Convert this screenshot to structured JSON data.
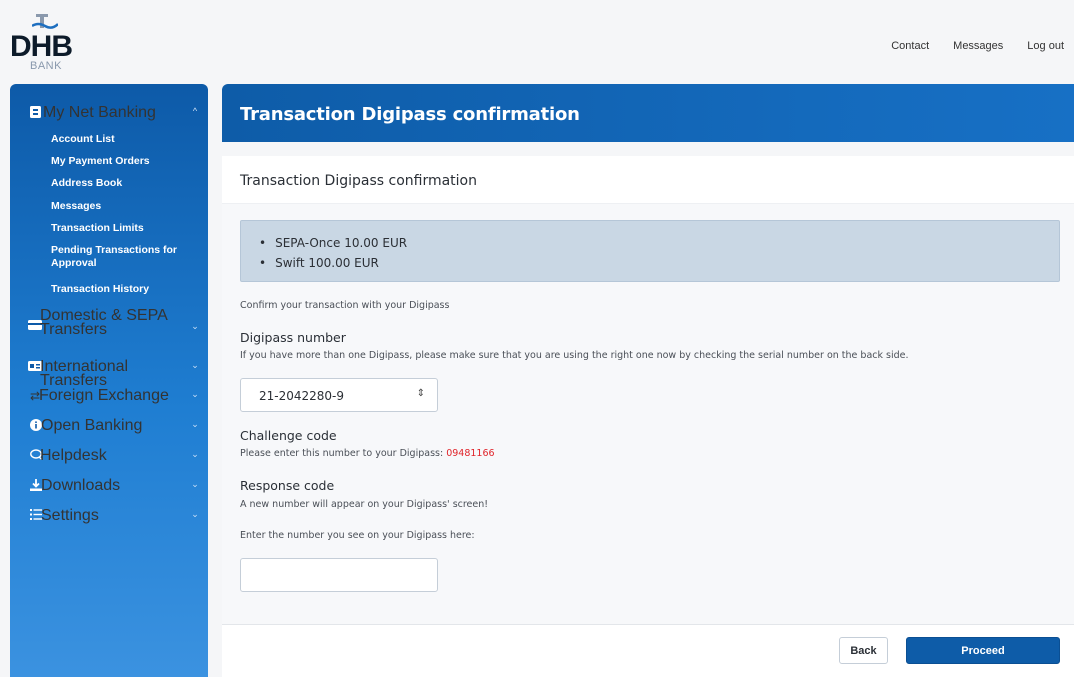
{
  "brand": {
    "name": "DHB",
    "sub": "BANK"
  },
  "top_nav": {
    "contact": "Contact",
    "messages": "Messages",
    "logout": "Log out"
  },
  "sidebar": {
    "my_net_banking": {
      "label": "My Net Banking",
      "icon": "account-icon",
      "items": [
        "Account List",
        "My Payment Orders",
        "Address Book",
        "Messages",
        "Transaction Limits",
        "Pending Transactions for Approval",
        "Transaction History"
      ]
    },
    "groups": [
      {
        "label": "Domestic & SEPA Transfers",
        "icon": "card-icon"
      },
      {
        "label": "International Transfers",
        "icon": "id-card-icon"
      },
      {
        "label": "Foreign Exchange",
        "icon": "exchange-icon"
      },
      {
        "label": "Open Banking",
        "icon": "info-icon"
      },
      {
        "label": "Helpdesk",
        "icon": "chat-icon"
      },
      {
        "label": "Downloads",
        "icon": "download-icon"
      },
      {
        "label": "Settings",
        "icon": "list-icon"
      }
    ]
  },
  "page": {
    "title": "Transaction Digipass confirmation",
    "card_title": "Transaction Digipass confirmation",
    "summary": [
      "SEPA-Once 10.00 EUR",
      "Swift 100.00 EUR"
    ],
    "confirm_text": "Confirm your transaction with your Digipass",
    "digipass_label": "Digipass number",
    "digipass_help": "If you have more than one Digipass, please make sure that you are using the right one now by checking the serial number on the back side.",
    "digipass_value": "21-2042280-9",
    "challenge_label": "Challenge code",
    "challenge_help": "Please enter this number to your Digipass: ",
    "challenge_code": "09481166",
    "response_label": "Response code",
    "response_help": "A new number will appear on your Digipass' screen!",
    "response_prompt": "Enter the number you see on your Digipass here:",
    "response_value": ""
  },
  "buttons": {
    "back": "Back",
    "proceed": "Proceed"
  },
  "colors": {
    "primary": "#0e5ca8",
    "challenge": "#e0242a",
    "summary_bg": "#c9d7e4"
  }
}
